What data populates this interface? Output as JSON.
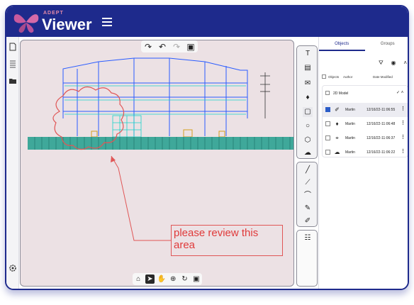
{
  "app": {
    "brand_small": "ADEPT",
    "brand_big": "Viewer"
  },
  "colors": {
    "header": "#1e2a8c",
    "accent": "#e58aa8",
    "annotation": "#e03a3a",
    "canvas": "#ece1e4"
  },
  "canvas": {
    "annotation_text": "please review this area",
    "top_tools": [
      "redo-icon",
      "undo-icon",
      "redo-disabled-icon",
      "save-icon"
    ],
    "bottom_tools": [
      "home-icon",
      "select-icon",
      "pan-icon",
      "zoom-icon",
      "rotate-icon",
      "save-icon"
    ]
  },
  "right_tools": [
    "text-icon",
    "callout-icon",
    "note-icon",
    "marker-icon",
    "rectangle-icon",
    "circle-icon",
    "polygon-icon",
    "cloud-icon",
    "line-icon",
    "measure-icon",
    "arc-icon",
    "pen-icon",
    "erase-icon",
    "layers-icon"
  ],
  "panel": {
    "tabs": [
      "Objects",
      "Groups"
    ],
    "columns": [
      "Objects",
      "Author",
      "Date Modified"
    ],
    "model_label": "2D Model",
    "rows": [
      {
        "icon": "✐",
        "author": "Martin",
        "date": "12/16/22-11:06:55",
        "selected": true
      },
      {
        "icon": "♦",
        "author": "Martin",
        "date": "12/16/22-11:06:48",
        "selected": false
      },
      {
        "icon": "⌖",
        "author": "Martin",
        "date": "12/16/22-11:06:37",
        "selected": false
      },
      {
        "icon": "☁",
        "author": "Martin",
        "date": "12/16/22-11:06:22",
        "selected": false
      }
    ]
  }
}
